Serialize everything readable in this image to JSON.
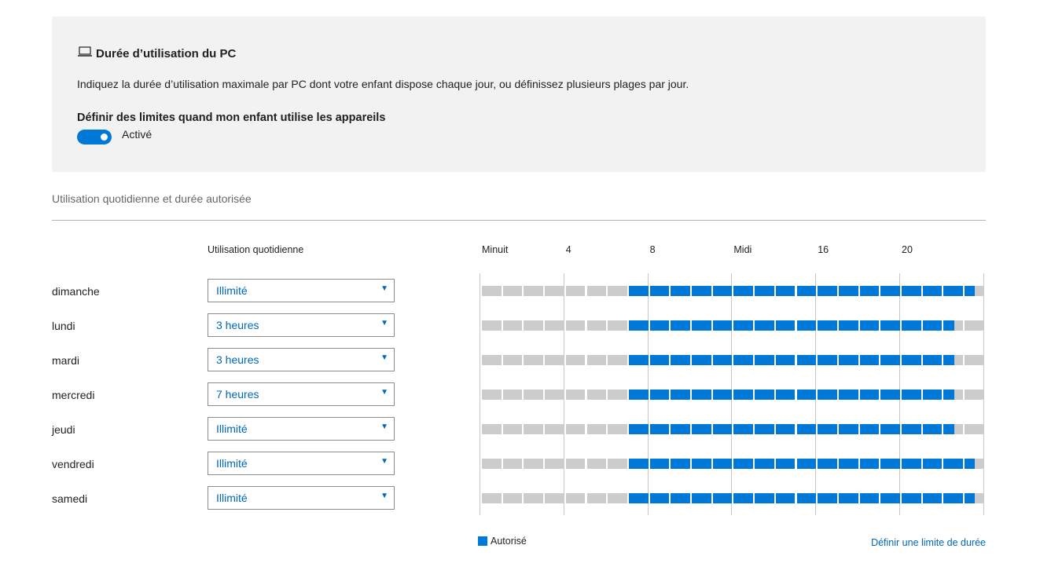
{
  "panel": {
    "title": "Durée d’utilisation du PC",
    "description": "Indiquez la durée d’utilisation maximale par PC dont votre enfant dispose chaque jour, ou définissez plusieurs plages par jour.",
    "limits_label": "Définir des limites quand mon enfant utilise les appareils",
    "toggle_on": true,
    "toggle_state": "Activé"
  },
  "section_title": "Utilisation quotidienne et durée autorisée",
  "column_header": "Utilisation quotidienne",
  "hour_labels": [
    "Minuit",
    "4",
    "8",
    "Midi",
    "16",
    "20"
  ],
  "days": [
    {
      "name": "dimanche",
      "limit": "Illimité",
      "allowed_from_hour": 7,
      "allowed_until_hour": 23.5
    },
    {
      "name": "lundi",
      "limit": "3 heures",
      "allowed_from_hour": 7,
      "allowed_until_hour": 22.5
    },
    {
      "name": "mardi",
      "limit": "3 heures",
      "allowed_from_hour": 7,
      "allowed_until_hour": 22.5
    },
    {
      "name": "mercredi",
      "limit": "7 heures",
      "allowed_from_hour": 7,
      "allowed_until_hour": 22.5
    },
    {
      "name": "jeudi",
      "limit": "Illimité",
      "allowed_from_hour": 7,
      "allowed_until_hour": 22.5
    },
    {
      "name": "vendredi",
      "limit": "Illimité",
      "allowed_from_hour": 7,
      "allowed_until_hour": 23.5
    },
    {
      "name": "samedi",
      "limit": "Illimité",
      "allowed_from_hour": 7,
      "allowed_until_hour": 23.5
    }
  ],
  "legend_label": "Autorisé",
  "link_label": "Définir une limite de durée",
  "colors": {
    "accent": "#0078d7",
    "allowed": "#0078d7",
    "blocked": "#cccccc",
    "panel_bg": "#f2f2f2",
    "link": "#0067b8"
  }
}
